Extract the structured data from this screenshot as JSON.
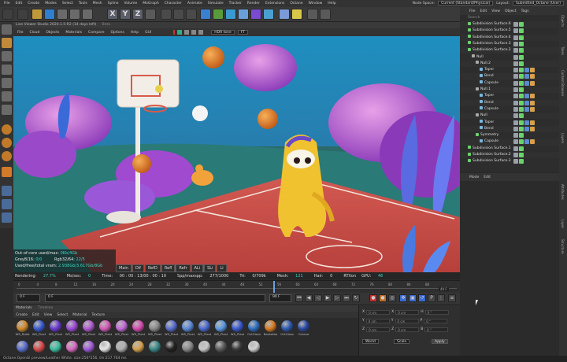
{
  "menubar": {
    "items": [
      "File",
      "Edit",
      "Create",
      "Modes",
      "Select",
      "Tools",
      "Mesh",
      "Spline",
      "Volume",
      "MoGraph",
      "Character",
      "Animate",
      "Simulate",
      "Tracker",
      "Render",
      "Extensions",
      "Octane",
      "Window",
      "Help"
    ],
    "node_space_label": "Node Space:",
    "node_space_value": "Current (Standard/Physical)",
    "layout_label": "Layout:",
    "layout_value": "Submitted_Octane (User)"
  },
  "toolbar": {
    "axis_x": "X",
    "axis_y": "Y",
    "axis_z": "Z"
  },
  "viewer": {
    "title": "Live Viewer Studio 2020.1.5-R2 (14 days left)",
    "title_extra": "Beta",
    "menu": [
      "File",
      "Cloud",
      "Objects",
      "Materials",
      "Compare",
      "Options",
      "Help",
      "GUI"
    ],
    "mode_value": "HDR tone",
    "fit_value": "FT"
  },
  "stats": {
    "line1_label": "Out-of-core used/max:",
    "line1_value": "0Kb/4Gb",
    "line2_label": "Grey8/16:",
    "line2_value": "0/0",
    "line2b_label": "Rgb32/64:",
    "line2b_value": "22/5",
    "line3_label": "Used/free/total vram:",
    "line3_value": "2.938Gb/3.617Gb/8Gb"
  },
  "passes": [
    "Main",
    "Dif",
    "RefD",
    "Refl",
    "Refr",
    "ALi",
    "SLi",
    "Li"
  ],
  "renderbar": {
    "rendering_label": "Rendering:",
    "rendering_value": "27.7%",
    "mssec_label": "Ms/sec:",
    "mssec_value": "0",
    "time_label": "Time:",
    "time_value": "00 : 00 : 13/00 : 00 : 10",
    "spp_label": "Spp/maxspp:",
    "spp_value": "277/1000",
    "tri_label": "Tri:",
    "tri_value": "0/709k",
    "mesh_label": "Mesh:",
    "mesh_value": "121",
    "hair_label": "Hair:",
    "hair_value": "0",
    "rtx_label": "RTXon",
    "gpu_label": "GPU:",
    "gpu_value": "46"
  },
  "timeline": {
    "ticks": [
      "0",
      "4",
      "8",
      "12",
      "16",
      "20",
      "24",
      "28",
      "32",
      "36",
      "40",
      "44",
      "48",
      "52",
      "56",
      "60",
      "64",
      "68",
      "72",
      "76",
      "80",
      "84",
      "88"
    ],
    "frame_a": "0 F",
    "frame_b": "0 F",
    "frame_c": "90 F",
    "current_frame": "49 F"
  },
  "materials": {
    "title": "Materials",
    "title_tab": "Timeline",
    "menu": [
      "Create",
      "Edit",
      "View",
      "Select",
      "Material",
      "Texture"
    ],
    "row1": [
      {
        "label": "WS_Rubb",
        "color": "#d08a2a"
      },
      {
        "label": "WS_Plast",
        "color": "#3a5bd0"
      },
      {
        "label": "WS_Plast",
        "color": "#6a3ad0"
      },
      {
        "label": "WS_Plast",
        "color": "#9b4ad8"
      },
      {
        "label": "WS_Plast",
        "color": "#b05ad0"
      },
      {
        "label": "WS_Plast",
        "color": "#d55ab8"
      },
      {
        "label": "WS_Plast",
        "color": "#c26ad8"
      },
      {
        "label": "WS_Plast",
        "color": "#d54ab0"
      },
      {
        "label": "WS_Plast",
        "color": "#8a8a8a"
      },
      {
        "label": "WS_Plast",
        "color": "#5a6fd0"
      },
      {
        "label": "WS_Plast",
        "color": "#5a88d8"
      },
      {
        "label": "WS_Plast",
        "color": "#4a6ad0"
      },
      {
        "label": "WS_Plast",
        "color": "#5a98e0"
      },
      {
        "label": "WS_Plast",
        "color": "#3a5ad0"
      },
      {
        "label": "OctGloss",
        "color": "#2e6ec0"
      },
      {
        "label": "Basketba",
        "color": "#d87a22"
      },
      {
        "label": "OctGloss",
        "color": "#2e5ab0"
      },
      {
        "label": "Octane",
        "color": "#2a4aa0"
      }
    ],
    "row2": [
      {
        "label": "",
        "color": "#5a6fd0"
      },
      {
        "label": "",
        "color": "#d84a4a"
      },
      {
        "label": "",
        "color": "#3ac0a0"
      },
      {
        "label": "",
        "color": "#d86ac0"
      },
      {
        "label": "",
        "color": "#a05ad8"
      },
      {
        "label": "",
        "color": "#e8e8e8"
      },
      {
        "label": "",
        "color": "#b0b0b0"
      },
      {
        "label": "",
        "color": "#d8a04a"
      },
      {
        "label": "",
        "color": "#3a8a8a"
      },
      {
        "label": "",
        "color": "#222222"
      },
      {
        "label": "",
        "color": "#8a8a8a"
      },
      {
        "label": "",
        "color": "#c8c8c8"
      },
      {
        "label": "",
        "color": "#5a5a5a"
      },
      {
        "label": "",
        "color": "#3a3a3a"
      },
      {
        "label": "",
        "color": "#d0d0d0"
      }
    ]
  },
  "coords": {
    "rows": [
      [
        "X",
        "0 cm",
        "X",
        "0 cm",
        "H",
        "0 °"
      ],
      [
        "Y",
        "0 cm",
        "Y",
        "0 cm",
        "P",
        "0 °"
      ],
      [
        "Z",
        "0 cm",
        "Z",
        "0 cm",
        "B",
        "0 °"
      ]
    ],
    "mode_value": "World",
    "size_value": "Scale",
    "apply_label": "Apply"
  },
  "objects": {
    "menu": [
      "File",
      "Edit",
      "View",
      "Object",
      "Tags"
    ],
    "search_placeholder": "Search",
    "items": [
      {
        "name": "Subdivision Surface.6",
        "indent": 0,
        "color": "#6bd36b"
      },
      {
        "name": "Subdivision Surface.5",
        "indent": 0,
        "color": "#6bd36b"
      },
      {
        "name": "Subdivision Surface.4",
        "indent": 0,
        "color": "#6bd36b"
      },
      {
        "name": "Subdivision Surface.3",
        "indent": 0,
        "color": "#6bd36b"
      },
      {
        "name": "Subdivision Surface.2",
        "indent": 0,
        "color": "#6bd36b"
      },
      {
        "name": "Null",
        "indent": 1,
        "color": "#aaaaaa"
      },
      {
        "name": "Null.2",
        "indent": 2,
        "color": "#aaaaaa"
      },
      {
        "name": "Taper",
        "indent": 3,
        "color": "#7ab8e0"
      },
      {
        "name": "Bend",
        "indent": 3,
        "color": "#7ab8e0"
      },
      {
        "name": "Capsule",
        "indent": 3,
        "color": "#7ab8e0"
      },
      {
        "name": "Null.1",
        "indent": 2,
        "color": "#aaaaaa"
      },
      {
        "name": "Taper",
        "indent": 3,
        "color": "#7ab8e0"
      },
      {
        "name": "Bend",
        "indent": 3,
        "color": "#7ab8e0"
      },
      {
        "name": "Capsule",
        "indent": 3,
        "color": "#7ab8e0"
      },
      {
        "name": "Null",
        "indent": 2,
        "color": "#aaaaaa"
      },
      {
        "name": "Taper",
        "indent": 3,
        "color": "#7ab8e0"
      },
      {
        "name": "Bend",
        "indent": 3,
        "color": "#7ab8e0"
      },
      {
        "name": "Symmetry",
        "indent": 2,
        "color": "#6bd36b"
      },
      {
        "name": "Capsule",
        "indent": 3,
        "color": "#7ab8e0"
      },
      {
        "name": "Subdivision Surface.1",
        "indent": 0,
        "color": "#6bd36b"
      },
      {
        "name": "Subdivision Surface.2",
        "indent": 0,
        "color": "#6bd36b"
      },
      {
        "name": "Subdivision Surface.3",
        "indent": 0,
        "color": "#6bd36b"
      }
    ]
  },
  "attributes": {
    "menu": [
      "Mode",
      "Edit"
    ]
  },
  "side_tabs": [
    "Objects",
    "Takes",
    "Content Browser",
    "Layers",
    "Attributes",
    "Layer",
    "Structure"
  ],
  "status": "Octane:OpenGl preview/Leather White. size:256*256, tm:217.764 ms"
}
